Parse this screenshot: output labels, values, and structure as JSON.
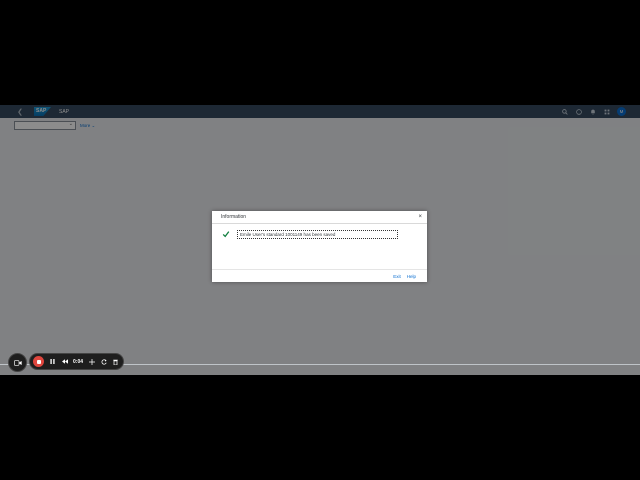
{
  "shell": {
    "logo": "SAP",
    "title": "SAP",
    "avatar": "M"
  },
  "toolbar": {
    "select_value": "",
    "more_label": "More ⌄"
  },
  "dialog": {
    "title": "Information",
    "close_label": "×",
    "message": "Emile User's standard 1001149 has been saved",
    "buttons": [
      "Exit",
      "Help"
    ]
  },
  "recorder": {
    "time": "0:04"
  },
  "colors": {
    "shell": "#354a5f",
    "accent": "#0a6ed1",
    "success": "#107e3e",
    "record": "#e0463e"
  }
}
